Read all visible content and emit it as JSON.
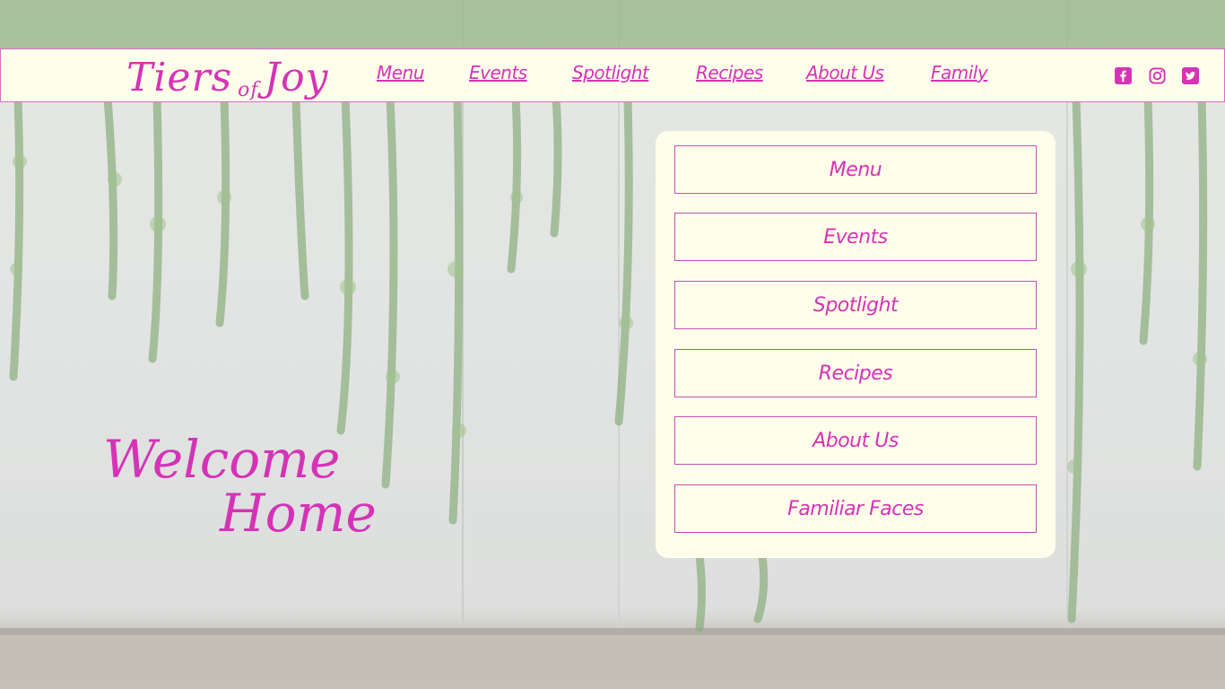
{
  "brand": {
    "logo_words": [
      "Tiers",
      "of",
      "Joy"
    ],
    "accent_color": "#d533b6",
    "bar_color": "#fffeea"
  },
  "nav": {
    "links": [
      "Menu",
      "Events",
      "Spotlight",
      "Recipes",
      "About Us",
      "Family"
    ]
  },
  "social": {
    "icons": [
      "facebook-icon",
      "instagram-icon",
      "twitter-icon"
    ]
  },
  "hero": {
    "line1": "Welcome",
    "line2": "Home"
  },
  "side_menu": {
    "buttons": [
      "Menu",
      "Events",
      "Spotlight",
      "Recipes",
      "About Us",
      "Familiar Faces"
    ]
  }
}
